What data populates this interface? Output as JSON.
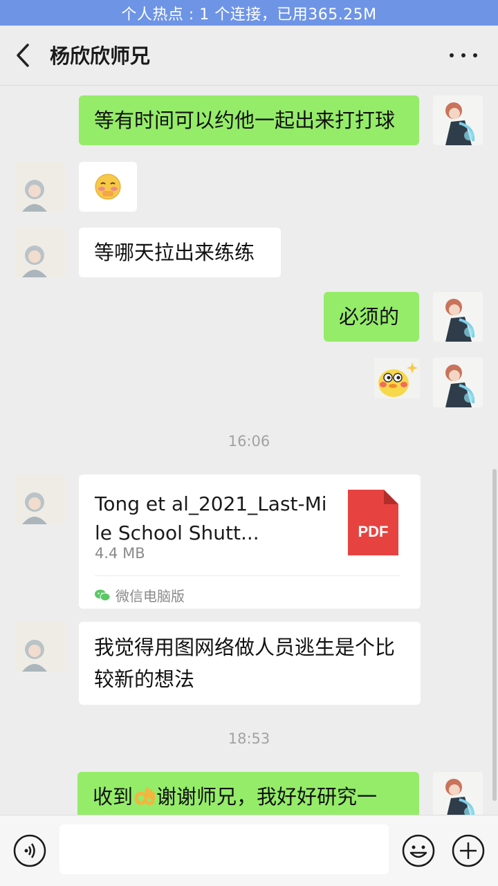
{
  "status_bar": {
    "hotspot_text": "个人热点 : 1 个连接，已用365.25M"
  },
  "header": {
    "title": "杨欣欣师兄"
  },
  "messages": {
    "m1": "等有时间可以约他一起出来打打球",
    "m3": "等哪天拉出来练练",
    "m4": "必须的",
    "time1": "16:06",
    "file": {
      "name": "Tong et al_2021_Last-Mile School Shutt...",
      "size": "4.4 MB",
      "badge": "PDF",
      "source": "微信电脑版"
    },
    "m6": "我觉得用图网络做人员逃生是个比较新的想法",
    "time2": "18:53",
    "m7_prefix": "收到",
    "m7_suffix": "谢谢师兄，我好好研究一"
  },
  "colors": {
    "self_bubble": "#95ec69",
    "other_bubble": "#ffffff",
    "pdf_red": "#e64340",
    "hotspot_bar": "#6e94e6"
  }
}
